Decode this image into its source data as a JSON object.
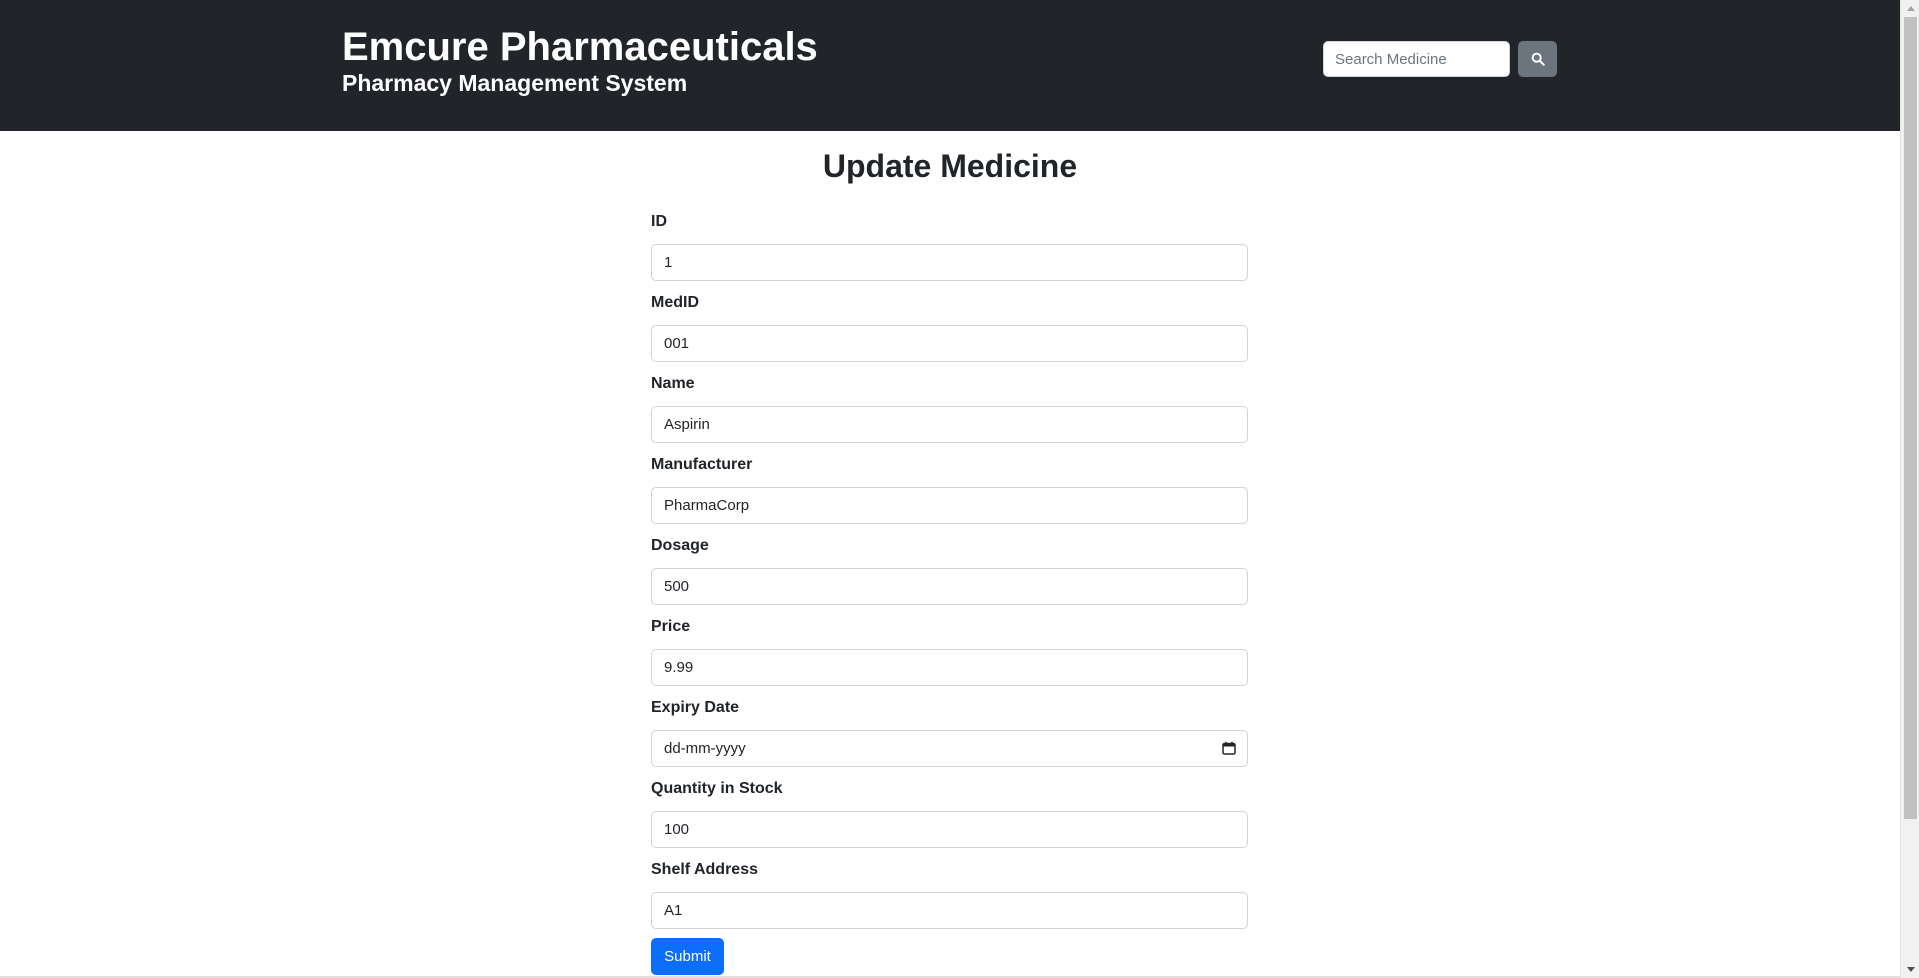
{
  "header": {
    "title": "Emcure Pharmaceuticals",
    "subtitle": "Pharmacy Management System",
    "search": {
      "placeholder": "Search Medicine",
      "value": ""
    },
    "search_button_icon": "search-icon"
  },
  "main": {
    "title": "Update Medicine",
    "fields": [
      {
        "label": "ID",
        "value": "1"
      },
      {
        "label": "MedID",
        "value": "001"
      },
      {
        "label": "Name",
        "value": "Aspirin"
      },
      {
        "label": "Manufacturer",
        "value": "PharmaCorp"
      },
      {
        "label": "Dosage",
        "value": "500"
      },
      {
        "label": "Price",
        "value": "9.99"
      },
      {
        "label": "Expiry Date",
        "value": "",
        "placeholder": "dd-mm-yyyy"
      },
      {
        "label": "Quantity in Stock",
        "value": "100"
      },
      {
        "label": "Shelf Address",
        "value": "A1"
      }
    ],
    "submit_label": "Submit"
  },
  "colors": {
    "header_bg": "#212529",
    "primary": "#0d6efd",
    "secondary": "#6c757d"
  }
}
